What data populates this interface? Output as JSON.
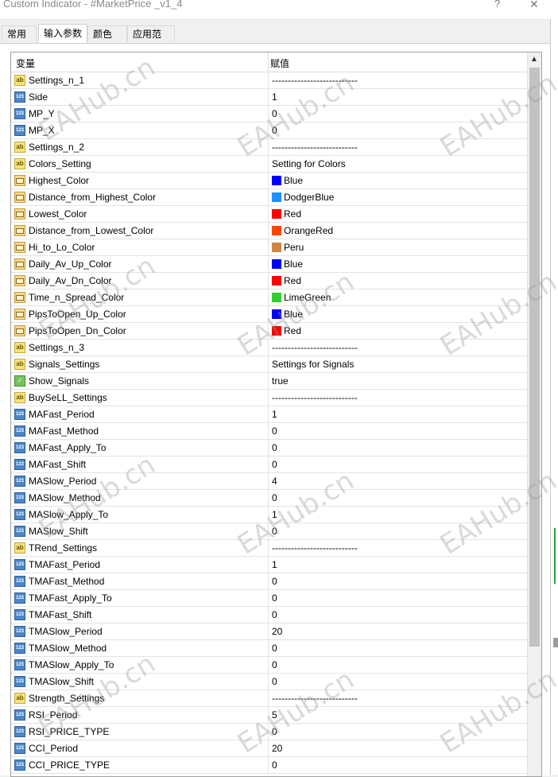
{
  "window": {
    "title": "Custom Indicator - #MarketPrice _v1_4",
    "help_label": "?",
    "close_label": "✕"
  },
  "tabs": [
    {
      "label": "常用"
    },
    {
      "label": "输入参数"
    },
    {
      "label": "颜色"
    },
    {
      "label": "应用范围"
    }
  ],
  "grid": {
    "col_variable": "变量",
    "col_value": "赋值"
  },
  "params": [
    {
      "type": "ab",
      "name": "Settings_n_1",
      "value": "---------------------------"
    },
    {
      "type": "123",
      "name": "Side",
      "value": "1"
    },
    {
      "type": "123",
      "name": "MP_Y",
      "value": "0"
    },
    {
      "type": "123",
      "name": "MP_X",
      "value": "0"
    },
    {
      "type": "ab",
      "name": "Settings_n_2",
      "value": "---------------------------"
    },
    {
      "type": "ab",
      "name": "Colors_Setting",
      "value": "Setting for Colors"
    },
    {
      "type": "color",
      "name": "Highest_Color",
      "value": "Blue",
      "swatch": "#0000ff"
    },
    {
      "type": "color",
      "name": "Distance_from_Highest_Color",
      "value": "DodgerBlue",
      "swatch": "#1e90ff"
    },
    {
      "type": "color",
      "name": "Lowest_Color",
      "value": "Red",
      "swatch": "#ff0000"
    },
    {
      "type": "color",
      "name": "Distance_from_Lowest_Color",
      "value": "OrangeRed",
      "swatch": "#ff4500"
    },
    {
      "type": "color",
      "name": "Hi_to_Lo_Color",
      "value": "Peru",
      "swatch": "#cd853f"
    },
    {
      "type": "color",
      "name": "Daily_Av_Up_Color",
      "value": "Blue",
      "swatch": "#0000ff"
    },
    {
      "type": "color",
      "name": "Daily_Av_Dn_Color",
      "value": "Red",
      "swatch": "#ff0000"
    },
    {
      "type": "color",
      "name": "Time_n_Spread_Color",
      "value": "LimeGreen",
      "swatch": "#32cd32"
    },
    {
      "type": "color",
      "name": "PipsToOpen_Up_Color",
      "value": "Blue",
      "swatch": "#0000ff"
    },
    {
      "type": "color",
      "name": "PipsToOpen_Dn_Color",
      "value": "Red",
      "swatch": "#ff0000"
    },
    {
      "type": "ab",
      "name": "Settings_n_3",
      "value": "---------------------------"
    },
    {
      "type": "ab",
      "name": "Signals_Settings",
      "value": "Settings for Signals"
    },
    {
      "type": "bool",
      "name": "Show_Signals",
      "value": "true"
    },
    {
      "type": "ab",
      "name": "BuySeLL_Settings",
      "value": "---------------------------"
    },
    {
      "type": "123",
      "name": "MAFast_Period",
      "value": "1"
    },
    {
      "type": "123",
      "name": "MAFast_Method",
      "value": "0"
    },
    {
      "type": "123",
      "name": "MAFast_Apply_To",
      "value": "0"
    },
    {
      "type": "123",
      "name": "MAFast_Shift",
      "value": "0"
    },
    {
      "type": "123",
      "name": "MASlow_Period",
      "value": "4"
    },
    {
      "type": "123",
      "name": "MASlow_Method",
      "value": "0"
    },
    {
      "type": "123",
      "name": "MASlow_Apply_To",
      "value": "1"
    },
    {
      "type": "123",
      "name": "MASlow_Shift",
      "value": "0"
    },
    {
      "type": "ab",
      "name": "TRend_Settings",
      "value": "---------------------------"
    },
    {
      "type": "123",
      "name": "TMAFast_Period",
      "value": "1"
    },
    {
      "type": "123",
      "name": "TMAFast_Method",
      "value": "0"
    },
    {
      "type": "123",
      "name": "TMAFast_Apply_To",
      "value": "0"
    },
    {
      "type": "123",
      "name": "TMAFast_Shift",
      "value": "0"
    },
    {
      "type": "123",
      "name": "TMASlow_Period",
      "value": "20"
    },
    {
      "type": "123",
      "name": "TMASlow_Method",
      "value": "0"
    },
    {
      "type": "123",
      "name": "TMASlow_Apply_To",
      "value": "0"
    },
    {
      "type": "123",
      "name": "TMASlow_Shift",
      "value": "0"
    },
    {
      "type": "ab",
      "name": "Strength_Settings",
      "value": "---------------------------"
    },
    {
      "type": "123",
      "name": "RSI_Period",
      "value": "5"
    },
    {
      "type": "123",
      "name": "RSI_PRICE_TYPE",
      "value": "0"
    },
    {
      "type": "123",
      "name": "CCI_Period",
      "value": "20"
    },
    {
      "type": "123",
      "name": "CCI_PRICE_TYPE",
      "value": "0"
    }
  ],
  "icons": {
    "ab": "ab",
    "123": "123",
    "bool": "✓"
  },
  "watermark": {
    "text": "EAHub.cn"
  }
}
